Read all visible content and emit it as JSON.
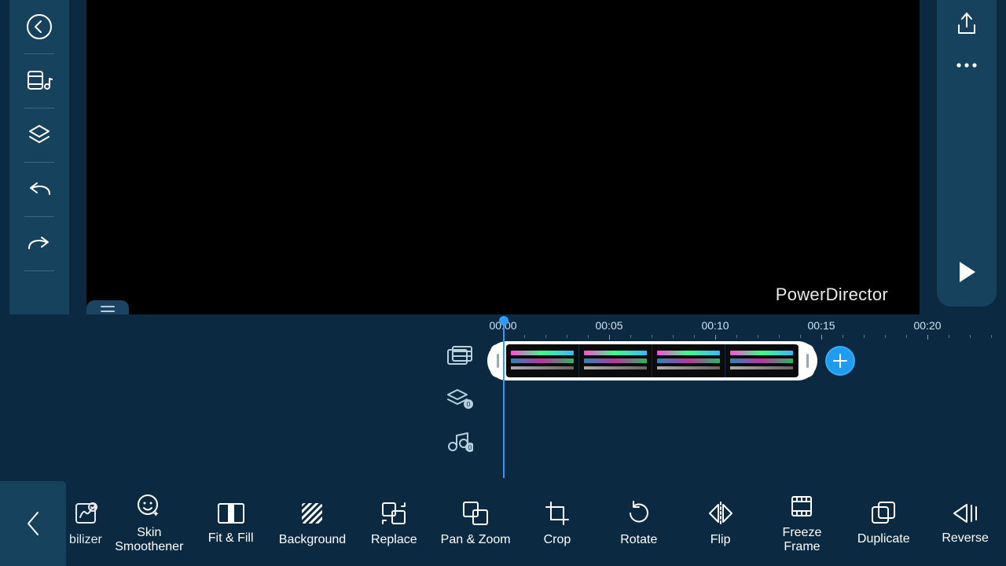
{
  "watermark": "PowerDirector",
  "sidebar_left": {
    "back": "back-icon",
    "media": "media-library-icon",
    "layers": "layers-icon",
    "undo": "undo-icon",
    "redo": "redo-icon",
    "trash": "trash-icon"
  },
  "sidebar_right": {
    "export": "export-icon",
    "more": "more-icon",
    "play": "play-icon"
  },
  "timeline": {
    "labels": [
      "00:00",
      "00:05",
      "00:10",
      "00:15",
      "00:20"
    ],
    "track_icons": [
      "video-track-icon",
      "overlay-track-icon",
      "audio-track-icon"
    ],
    "add": "add-clip-icon"
  },
  "tools": [
    {
      "id": "stabilizer",
      "label": "bilizer",
      "partial": true
    },
    {
      "id": "skin",
      "label": "Skin\nSmoothener"
    },
    {
      "id": "fitfill",
      "label": "Fit & Fill"
    },
    {
      "id": "background",
      "label": "Background"
    },
    {
      "id": "replace",
      "label": "Replace"
    },
    {
      "id": "panzoom",
      "label": "Pan & Zoom"
    },
    {
      "id": "crop",
      "label": "Crop"
    },
    {
      "id": "rotate",
      "label": "Rotate"
    },
    {
      "id": "flip",
      "label": "Flip"
    },
    {
      "id": "freeze",
      "label": "Freeze\nFrame"
    },
    {
      "id": "duplicate",
      "label": "Duplicate"
    },
    {
      "id": "reverse",
      "label": "Reverse"
    }
  ],
  "back_button": "chevron-left-icon",
  "menu_tab": "menu-icon"
}
